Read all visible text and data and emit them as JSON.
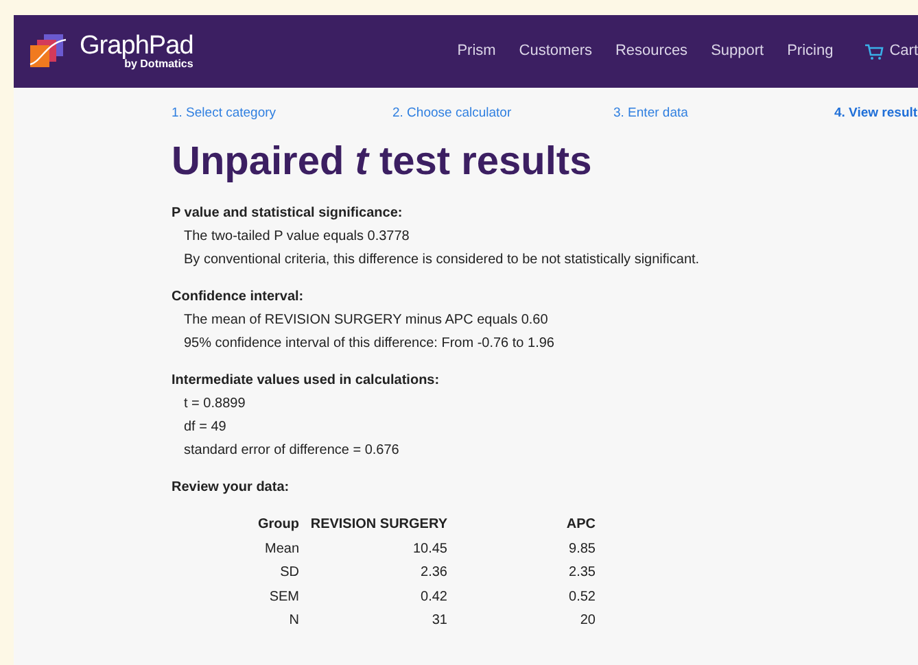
{
  "header": {
    "logo": {
      "name": "GraphPad",
      "tagline": "by Dotmatics"
    },
    "nav": [
      {
        "label": "Prism",
        "kind": "link"
      },
      {
        "label": "Customers",
        "kind": "link"
      },
      {
        "label": "Resources",
        "kind": "link"
      },
      {
        "label": "Support",
        "kind": "link"
      },
      {
        "label": "Pricing",
        "kind": "link"
      },
      {
        "label": "Cart",
        "kind": "cart"
      }
    ]
  },
  "steps": [
    {
      "label": "1. Select category",
      "selected": false
    },
    {
      "label": "2. Choose calculator",
      "selected": false
    },
    {
      "label": "3. Enter data",
      "selected": false
    },
    {
      "label": "4. View result",
      "selected": true
    }
  ],
  "title": "Unpaired *t* test results",
  "sections": [
    {
      "heading": "P value and statistical significance:",
      "lines": [
        "The two-tailed P value equals 0.3778",
        "By conventional criteria, this difference is considered to be not statistically significant."
      ]
    },
    {
      "heading": "Confidence interval:",
      "lines": [
        "The mean of REVISION SURGERY minus APC equals 0.60",
        "95% confidence interval of this difference: From -0.76 to 1.96"
      ]
    },
    {
      "heading": "Intermediate values used in calculations:",
      "lines": [
        "t = 0.8899",
        "df = 49",
        "standard error of difference = 0.676"
      ]
    }
  ],
  "review": {
    "heading": "Review your data:",
    "columns": [
      "Group",
      "REVISION SURGERY",
      "APC"
    ],
    "rows": [
      [
        "Mean",
        "10.45",
        "9.85"
      ],
      [
        "SD",
        "2.36",
        "2.35"
      ],
      [
        "SEM",
        "0.42",
        "0.52"
      ],
      [
        "N",
        "31",
        "20"
      ]
    ]
  }
}
